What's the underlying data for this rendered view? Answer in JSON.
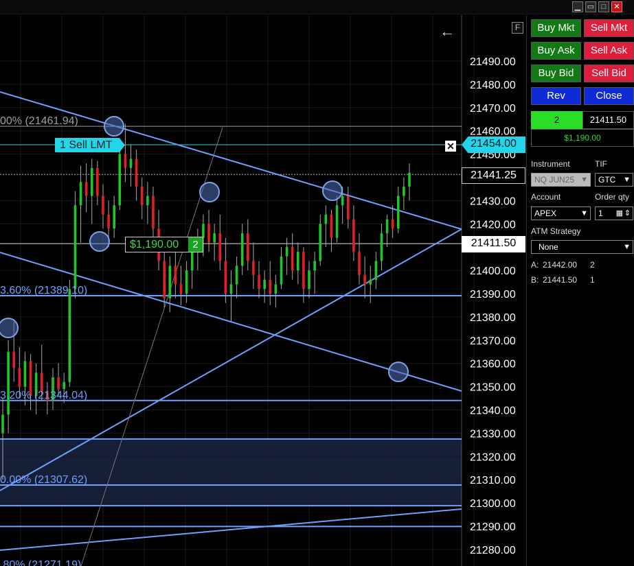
{
  "window": {
    "buttons": [
      "minimize",
      "restore",
      "maximize",
      "close"
    ]
  },
  "chart": {
    "f_button": "F",
    "price_axis": [
      "21490.00",
      "21480.00",
      "21470.00",
      "21460.00",
      "21450.00",
      "21441.25",
      "21430.00",
      "21420.00",
      "21411.50",
      "21400.00",
      "21390.00",
      "21380.00",
      "21370.00",
      "21360.00",
      "21350.00",
      "21340.00",
      "21330.00",
      "21320.00",
      "21310.00",
      "21300.00",
      "21290.00",
      "21280.00"
    ],
    "fib_labels": [
      {
        "text": "00% (21461.94)",
        "color": "#9aa0a6"
      },
      {
        "text": "3.60% (21389.10)",
        "color": "#6fa0ff"
      },
      {
        "text": "3.20% (21344.04)",
        "color": "#6fa0ff"
      },
      {
        "text": "0.00% (21307.62)",
        "color": "#6fa0ff"
      },
      {
        "text": ".80% (21271.19)",
        "color": "#6fa0ff"
      }
    ],
    "order_tag": "1 Sell LMT",
    "order_price": "21454.00",
    "last_price": "21441.25",
    "entry_price": "21411.50",
    "pnl_value": "$1,190.00",
    "pnl_qty": "2",
    "candles": [
      [
        21330,
        21345,
        21310,
        21338
      ],
      [
        21338,
        21370,
        21330,
        21365
      ],
      [
        21365,
        21378,
        21352,
        21358
      ],
      [
        21358,
        21367,
        21345,
        21350
      ],
      [
        21350,
        21365,
        21342,
        21361
      ],
      [
        21361,
        21364,
        21340,
        21346
      ],
      [
        21346,
        21360,
        21338,
        21356
      ],
      [
        21356,
        21368,
        21344,
        21348
      ],
      [
        21348,
        21352,
        21338,
        21344
      ],
      [
        21344,
        21358,
        21340,
        21354
      ],
      [
        21354,
        21360,
        21346,
        21349
      ],
      [
        21349,
        21356,
        21343,
        21352
      ],
      [
        21352,
        21396,
        21350,
        21392
      ],
      [
        21392,
        21434,
        21388,
        21428
      ],
      [
        21428,
        21445,
        21412,
        21438
      ],
      [
        21438,
        21446,
        21425,
        21432
      ],
      [
        21432,
        21448,
        21420,
        21444
      ],
      [
        21444,
        21447,
        21428,
        21432
      ],
      [
        21432,
        21437,
        21418,
        21424
      ],
      [
        21424,
        21430,
        21410,
        21418
      ],
      [
        21418,
        21432,
        21414,
        21428
      ],
      [
        21428,
        21455,
        21426,
        21450
      ],
      [
        21450,
        21463,
        21438,
        21444
      ],
      [
        21444,
        21454,
        21436,
        21448
      ],
      [
        21448,
        21452,
        21430,
        21436
      ],
      [
        21436,
        21440,
        21422,
        21428
      ],
      [
        21428,
        21438,
        21420,
        21432
      ],
      [
        21432,
        21436,
        21412,
        21418
      ],
      [
        21418,
        21426,
        21400,
        21404
      ],
      [
        21404,
        21410,
        21384,
        21388
      ],
      [
        21388,
        21406,
        21382,
        21402
      ],
      [
        21402,
        21408,
        21388,
        21394
      ],
      [
        21394,
        21402,
        21385,
        21390
      ],
      [
        21390,
        21404,
        21386,
        21400
      ],
      [
        21400,
        21412,
        21392,
        21408
      ],
      [
        21408,
        21418,
        21400,
        21414
      ],
      [
        21414,
        21424,
        21406,
        21420
      ],
      [
        21420,
        21426,
        21408,
        21412
      ],
      [
        21412,
        21420,
        21404,
        21416
      ],
      [
        21416,
        21424,
        21400,
        21404
      ],
      [
        21404,
        21414,
        21386,
        21390
      ],
      [
        21390,
        21400,
        21378,
        21394
      ],
      [
        21394,
        21406,
        21388,
        21402
      ],
      [
        21402,
        21420,
        21398,
        21416
      ],
      [
        21416,
        21422,
        21400,
        21404
      ],
      [
        21404,
        21412,
        21392,
        21398
      ],
      [
        21398,
        21404,
        21388,
        21392
      ],
      [
        21392,
        21400,
        21386,
        21396
      ],
      [
        21396,
        21404,
        21385,
        21390
      ],
      [
        21390,
        21398,
        21384,
        21394
      ],
      [
        21394,
        21410,
        21392,
        21406
      ],
      [
        21406,
        21414,
        21398,
        21410
      ],
      [
        21410,
        21416,
        21396,
        21400
      ],
      [
        21400,
        21412,
        21394,
        21408
      ],
      [
        21408,
        21410,
        21386,
        21392
      ],
      [
        21392,
        21404,
        21388,
        21400
      ],
      [
        21400,
        21408,
        21390,
        21404
      ],
      [
        21404,
        21424,
        21402,
        21420
      ],
      [
        21420,
        21428,
        21410,
        21424
      ],
      [
        21424,
        21426,
        21408,
        21414
      ],
      [
        21414,
        21432,
        21412,
        21428
      ],
      [
        21428,
        21436,
        21420,
        21432
      ],
      [
        21432,
        21436,
        21418,
        21422
      ],
      [
        21422,
        21428,
        21404,
        21408
      ],
      [
        21408,
        21416,
        21394,
        21398
      ],
      [
        21398,
        21406,
        21388,
        21394
      ],
      [
        21394,
        21402,
        21386,
        21396
      ],
      [
        21396,
        21408,
        21392,
        21404
      ],
      [
        21404,
        21420,
        21400,
        21416
      ],
      [
        21416,
        21424,
        21410,
        21422
      ],
      [
        21422,
        21428,
        21414,
        21418
      ],
      [
        21418,
        21436,
        21416,
        21432
      ],
      [
        21432,
        21440,
        21426,
        21436
      ],
      [
        21436,
        21446,
        21430,
        21442
      ]
    ]
  },
  "panel": {
    "buttons": {
      "buy_mkt": "Buy Mkt",
      "sell_mkt": "Sell Mkt",
      "buy_ask": "Buy Ask",
      "sell_ask": "Sell Ask",
      "buy_bid": "Buy Bid",
      "sell_bid": "Sell Bid",
      "rev": "Rev",
      "close": "Close"
    },
    "position": {
      "qty": "2",
      "price": "21411.50",
      "pnl": "$1,190.00"
    },
    "labels": {
      "instrument": "Instrument",
      "tif": "TIF",
      "account": "Account",
      "order_qty": "Order qty",
      "atm_strategy": "ATM Strategy"
    },
    "values": {
      "instrument": "NQ JUN25",
      "tif": "GTC",
      "account": "APEX",
      "order_qty": "1",
      "atm_strategy": "None"
    },
    "market": {
      "ask_label": "A:",
      "ask_price": "21442.00",
      "ask_size": "2",
      "bid_label": "B:",
      "bid_price": "21441.50",
      "bid_size": "1"
    }
  },
  "colors": {
    "fib_line": "#6fa0ff",
    "order_line": "#23d5e8",
    "up_candle": "#22c42e",
    "down_candle": "#e01f26"
  }
}
